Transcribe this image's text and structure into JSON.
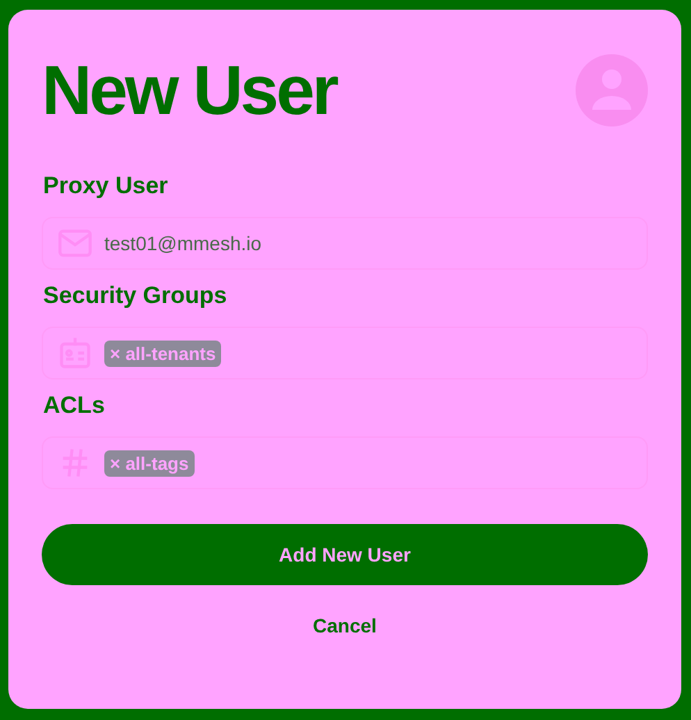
{
  "title": "New User",
  "fields": [
    {
      "label": "Proxy User",
      "kind": "text",
      "value": "test01@mmesh.io"
    },
    {
      "label": "Security Groups",
      "kind": "tags",
      "tags": [
        "× all-tenants"
      ]
    },
    {
      "label": "ACLs",
      "kind": "tags",
      "tags": [
        "× all-tags"
      ]
    }
  ],
  "submit": "Add New User",
  "cancel": "Cancel"
}
